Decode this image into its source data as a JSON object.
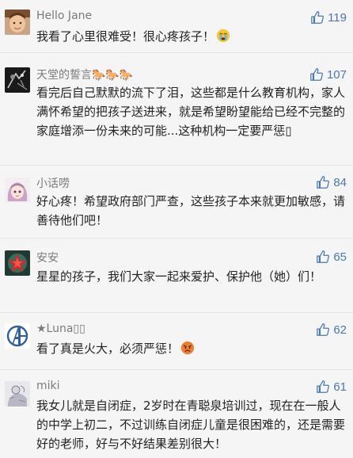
{
  "comments": [
    {
      "username": "Hello Jane",
      "likes": "119",
      "text": "我看了心里很难受！很心疼孩子！",
      "emoji": "crying-face-icon"
    },
    {
      "username": "天堂的誓言🐎🐎🐎",
      "likes": "107",
      "text": "看完后自己默默的流下了泪，这些都是什么教育机构，家人满怀希望的把孩子送进来，就是希望盼望能给已经不完整的家庭增添一份未来的可能...这种机构一定要严惩▯"
    },
    {
      "username": "小话唠",
      "likes": "84",
      "text": "好心疼！希望政府部门严查，这些孩子本来就更加敏感，请善待他们吧！"
    },
    {
      "username": "安安",
      "likes": "65",
      "text": "星星的孩子，我们大家一起来爱护、保护他（她）们！"
    },
    {
      "username": "★Luna▯▯",
      "likes": "62",
      "text": "看了真是火大，必须严惩！",
      "emoji": "angry-face-icon"
    },
    {
      "username": "miki",
      "likes": "61",
      "text": "我女儿就是自闭症，2岁时在青聪泉培训过，现在在一般人的中学上初二，不过训练自闭症儿童是很困难的，还是需要好的老师，好与不好结果差别很大！"
    }
  ],
  "colors": {
    "background": "#f5f5f5",
    "username": "#7a7a7a",
    "like_accent": "#4a78ad",
    "divider": "#e3e3e3"
  }
}
